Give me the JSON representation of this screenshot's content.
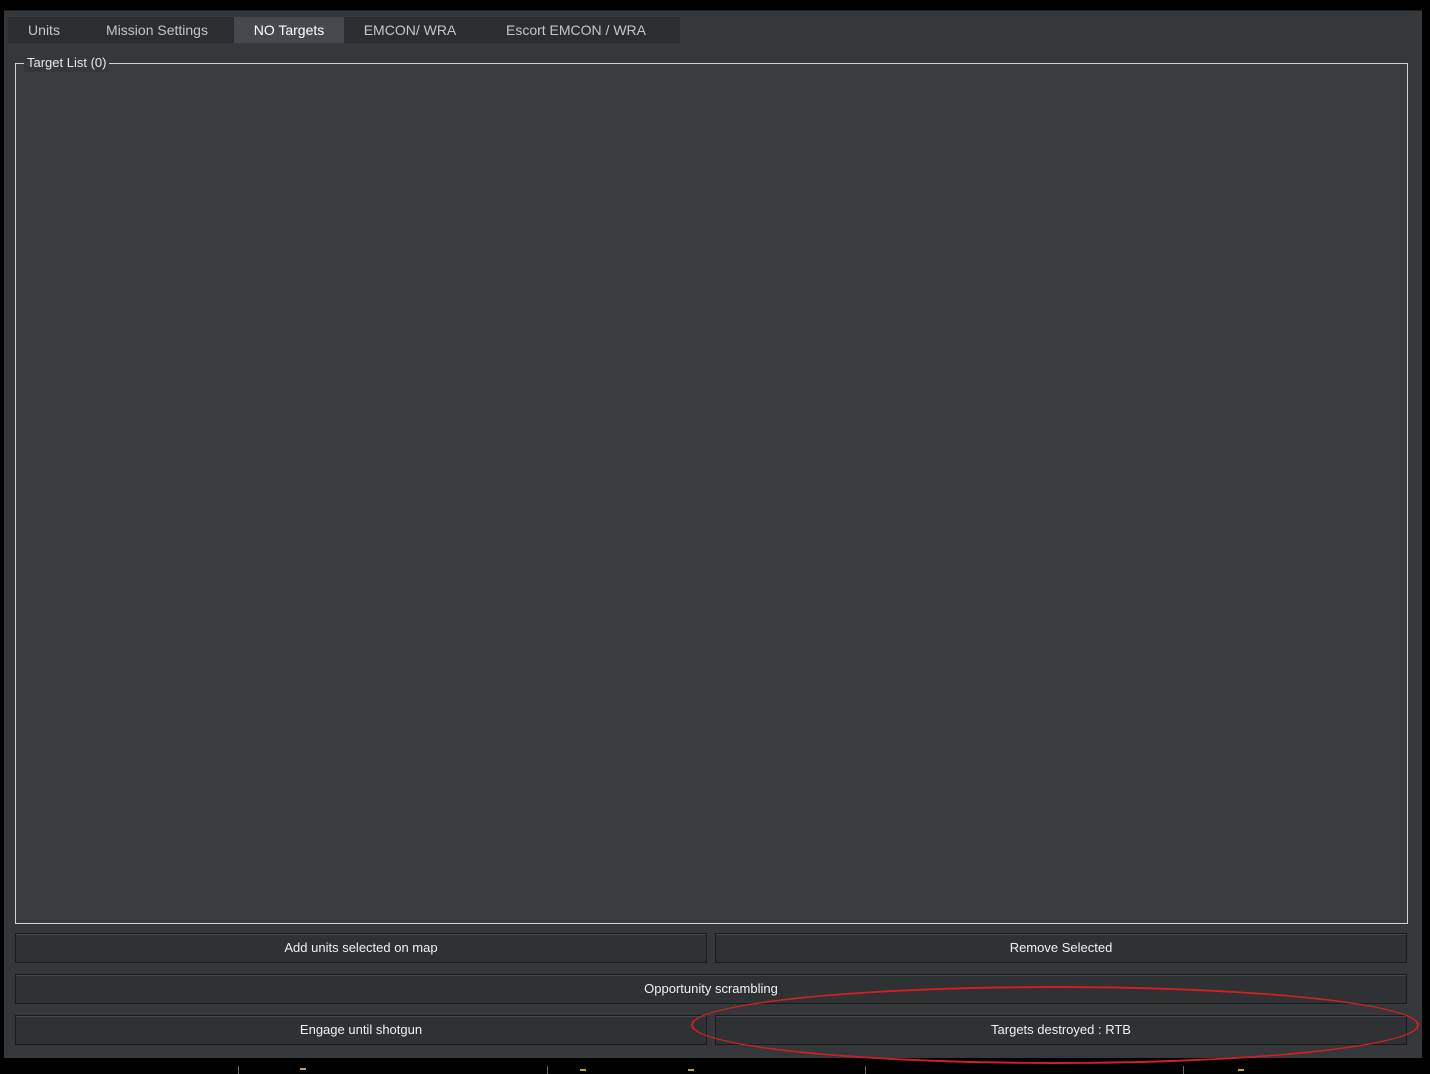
{
  "tabs": [
    {
      "label": "Units",
      "active": false
    },
    {
      "label": "Mission Settings",
      "active": false
    },
    {
      "label": "NO Targets",
      "active": true
    },
    {
      "label": "EMCON/ WRA",
      "active": false
    },
    {
      "label": "Escort EMCON / WRA",
      "active": false
    }
  ],
  "target_list": {
    "title": "Target List (0)"
  },
  "buttons": {
    "add_units": "Add units selected on map",
    "remove_selected": "Remove Selected",
    "opportunity_scrambling": "Opportunity scrambling",
    "engage_until_shotgun": "Engage until shotgun",
    "targets_destroyed": "Targets destroyed : RTB"
  },
  "annotation_color": "#d21f26"
}
